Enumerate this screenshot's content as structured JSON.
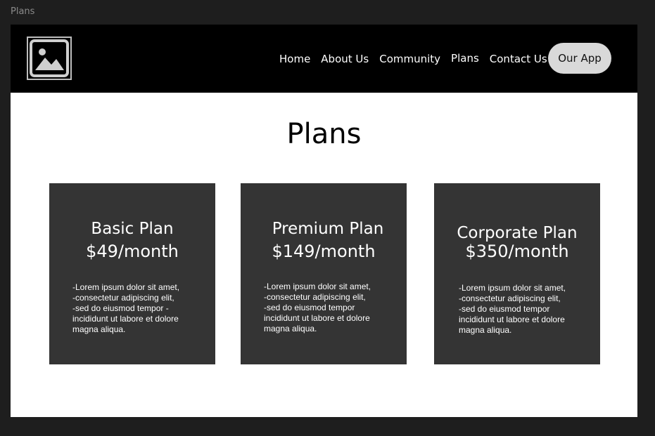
{
  "window": {
    "frame_label": "Plans"
  },
  "header": {
    "logo_icon": "image-icon",
    "nav": [
      "Home",
      "About Us",
      "Community",
      "Plans",
      "Contact Us"
    ],
    "app_button": "Our App"
  },
  "main": {
    "title": "Plans",
    "plans": [
      {
        "name": "Basic Plan",
        "price": "$49/month",
        "features": [
          "-Lorem ipsum dolor sit amet,",
          "-consectetur adipiscing elit,",
          "-sed do eiusmod tempor -",
          "incididunt ut labore et dolore",
          "magna aliqua."
        ]
      },
      {
        "name": "Premium Plan",
        "price": "$149/month",
        "features": [
          "-Lorem ipsum dolor sit amet,",
          "-consectetur adipiscing elit,",
          "-sed do eiusmod tempor",
          "incididunt ut labore et dolore",
          "magna aliqua."
        ]
      },
      {
        "name": "Corporate Plan",
        "price": "$350/month",
        "features": [
          "-Lorem ipsum dolor sit amet,",
          "-consectetur adipiscing elit,",
          "-sed do eiusmod tempor",
          "incididunt ut labore et dolore",
          "magna aliqua."
        ]
      }
    ]
  },
  "colors": {
    "canvas": "#1e1e1e",
    "navbar": "#000000",
    "card": "#343434",
    "button": "#d9d9d9"
  }
}
